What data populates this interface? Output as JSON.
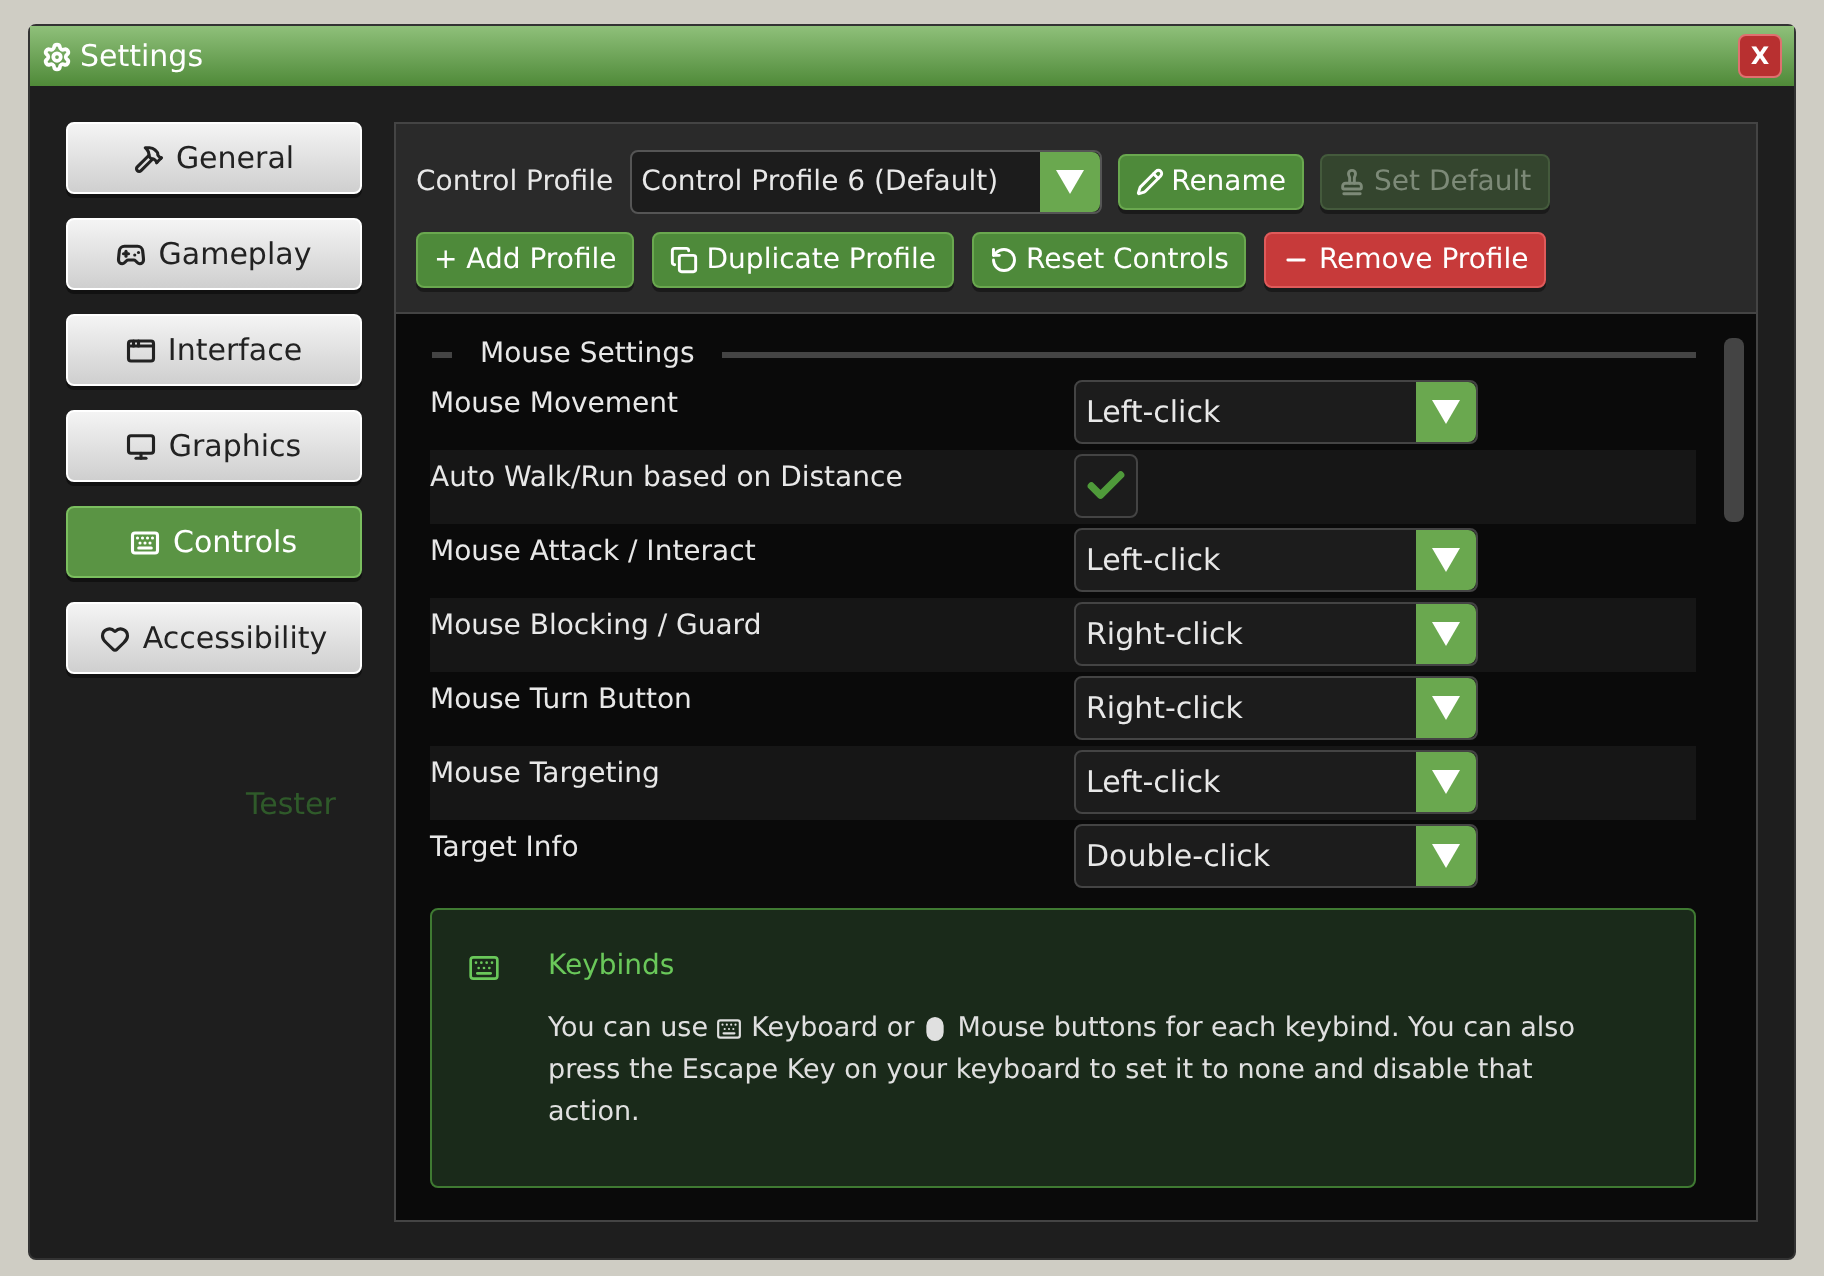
{
  "window": {
    "title": "Settings",
    "close": "X"
  },
  "background": {
    "text": "Tester"
  },
  "sidebar": {
    "items": [
      {
        "label": "General",
        "selected": false
      },
      {
        "label": "Gameplay",
        "selected": false
      },
      {
        "label": "Interface",
        "selected": false
      },
      {
        "label": "Graphics",
        "selected": false
      },
      {
        "label": "Controls",
        "selected": true
      },
      {
        "label": "Accessibility",
        "selected": false
      }
    ]
  },
  "profile": {
    "label": "Control Profile",
    "value": "Control Profile 6 (Default)",
    "buttons": [
      {
        "label": "Rename",
        "kind": "primary",
        "disabled": false
      },
      {
        "label": "Set Default",
        "kind": "primary",
        "disabled": true
      },
      {
        "label": "+ Add Profile",
        "kind": "primary",
        "disabled": false
      },
      {
        "label": "Duplicate Profile",
        "kind": "primary",
        "disabled": false
      },
      {
        "label": "Reset Controls",
        "kind": "primary",
        "disabled": false
      },
      {
        "label": "Remove Profile",
        "kind": "danger",
        "disabled": false
      }
    ]
  },
  "section": {
    "title": "Mouse Settings",
    "expanded": true,
    "rows": [
      {
        "label": "Mouse Movement",
        "kind": "select",
        "value": "Left-click"
      },
      {
        "label": "Auto Walk/Run based on Distance",
        "kind": "checkbox",
        "checked": true
      },
      {
        "label": "Mouse Attack / Interact",
        "kind": "select",
        "value": "Left-click"
      },
      {
        "label": "Mouse Blocking / Guard",
        "kind": "select",
        "value": "Right-click"
      },
      {
        "label": "Mouse Turn Button",
        "kind": "select",
        "value": "Right-click"
      },
      {
        "label": "Mouse Targeting",
        "kind": "select",
        "value": "Left-click"
      },
      {
        "label": "Target Info",
        "kind": "select",
        "value": "Double-click"
      }
    ]
  },
  "info": {
    "title": "Keybinds",
    "parts": [
      "You can use",
      "Keyboard or",
      "Mouse buttons for each keybind. You can also press the Escape Key on your keyboard to set it to none and disable that action."
    ]
  }
}
